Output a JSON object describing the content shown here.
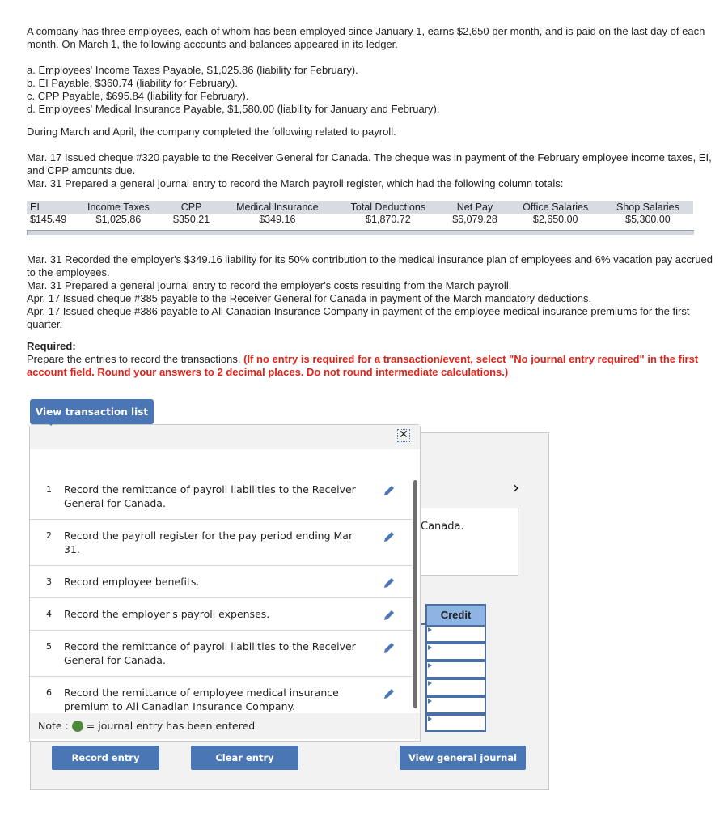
{
  "problem": {
    "intro": "A company has three employees, each of whom has been employed since January 1, earns $2,650 per month, and is paid on the last day of each month. On March 1, the following accounts and balances appeared in its ledger.",
    "accounts": [
      "a. Employees' Income Taxes Payable, $1,025.86 (liability for February).",
      "b. EI Payable, $360.74 (liability for February).",
      "c. CPP Payable, $695.84 (liability for February).",
      "d. Employees' Medical Insurance Payable, $1,580.00 (liability for January and February)."
    ],
    "during": "During March and April, the company completed the following related to payroll.",
    "events_before_table": [
      "Mar. 17 Issued cheque #320 payable to the Receiver General for Canada. The cheque was in payment of the February employee income taxes, EI, and CPP amounts due.",
      "Mar. 31 Prepared a general journal entry to record the March payroll register, which had the following column totals:"
    ],
    "register": {
      "headers": [
        "EI",
        "Income Taxes",
        "CPP",
        "Medical Insurance",
        "Total Deductions",
        "Net Pay",
        "Office Salaries",
        "Shop Salaries"
      ],
      "values": [
        "$145.49",
        "$1,025.86",
        "$350.21",
        "$349.16",
        "$1,870.72",
        "$6,079.28",
        "$2,650.00",
        "$5,300.00"
      ]
    },
    "events_after_table": [
      "Mar. 31 Recorded the employer's $349.16 liability for its 50% contribution to the medical insurance plan of employees and 6% vacation pay accrued to the employees.",
      "Mar. 31 Prepared a general journal entry to record the employer's costs resulting from the March payroll.",
      "Apr. 17 Issued cheque #385 payable to the Receiver General for Canada in payment of the March mandatory deductions.",
      "Apr. 17 Issued cheque #386 payable to All Canadian Insurance Company in payment of the employee medical insurance premiums for the first quarter."
    ],
    "required_label": "Required:",
    "required_text": "Prepare the entries to record the transactions.",
    "required_instructions": "(If no entry is required for a transaction/event, select \"No journal entry required\" in the first account field. Round your answers to 2 decimal places. Do not round intermediate calculations.)"
  },
  "transaction_list": {
    "toggle_label": "View transaction list",
    "close_icon": "close-icon",
    "items": [
      {
        "num": "1",
        "text": "Record the remittance of payroll liabilities to the Receiver General for Canada."
      },
      {
        "num": "2",
        "text": "Record the payroll register for the pay period ending Mar 31."
      },
      {
        "num": "3",
        "text": "Record employee benefits."
      },
      {
        "num": "4",
        "text": "Record the employer's payroll expenses."
      },
      {
        "num": "5",
        "text": "Record the remittance of payroll liabilities to the Receiver General for Canada."
      },
      {
        "num": "6",
        "text": "Record the remittance of employee medical insurance premium to All Canadian Insurance Company."
      }
    ],
    "note_prefix": "Note :",
    "note_suffix": "= journal entry has been entered",
    "entered_color": "#4d8a3e"
  },
  "journal": {
    "partial_description": "Canada.",
    "credit_header": "Credit",
    "next_icon": "chevron-right-icon"
  },
  "buttons": {
    "record": "Record entry",
    "clear": "Clear entry",
    "view_journal": "View general journal"
  },
  "colors": {
    "accent": "#4a76b5",
    "warning_text": "#e2231a",
    "credit_header": "#8eb4e3"
  }
}
